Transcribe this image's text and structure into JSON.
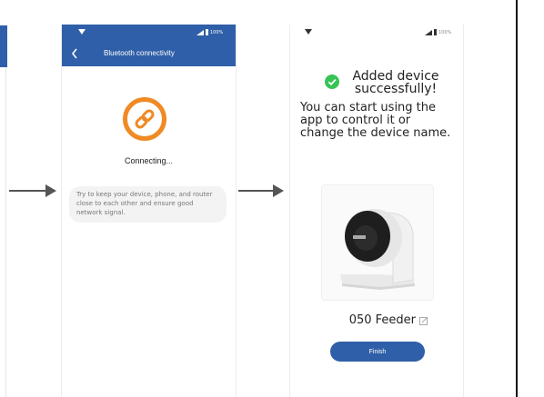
{
  "screen2": {
    "header_title": "Bluetooth connectivity",
    "status": "Connecting...",
    "tip": "Try to keep your device, phone, and router close to each other and ensure good network signal.",
    "battery": "100%"
  },
  "screen3": {
    "success_title": "Added device successfully!",
    "description": "You can start using the app to control it or change the device name.",
    "device_name": "050 Feeder",
    "finish_label": "Finish",
    "battery": "100%"
  },
  "colors": {
    "header_blue": "#2f5fa8",
    "connect_orange": "#f08a24",
    "success_green": "#36c455"
  },
  "icons": {
    "back": "chevron-left-icon",
    "link": "link-chain-icon",
    "check": "check-circle-icon",
    "edit": "edit-icon"
  }
}
